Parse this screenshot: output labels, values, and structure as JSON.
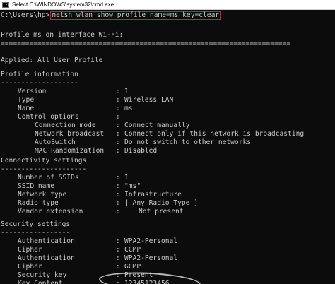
{
  "window": {
    "title": "Select C:\\WINDOWS\\system32\\cmd.exe",
    "icon": "cmd-icon"
  },
  "console": {
    "prompt": "C:\\Users\\hp>",
    "command": "netsh wlan show profile name=ms key=clear",
    "header": "Profile ms on interface Wi-Fi:",
    "rule": "=======================================================================",
    "applied": "Applied: All User Profile",
    "sections": {
      "profile_info": {
        "title": "Profile information",
        "dash": "-------------------",
        "rows": [
          {
            "key": "Version",
            "sep": ":",
            "val": "1",
            "indent": 1
          },
          {
            "key": "Type",
            "sep": ":",
            "val": "Wireless LAN",
            "indent": 1
          },
          {
            "key": "Name",
            "sep": ":",
            "val": "ms",
            "indent": 1
          },
          {
            "key": "Control options",
            "sep": ":",
            "val": "",
            "indent": 1
          },
          {
            "key": "Connection mode",
            "sep": ":",
            "val": "Connect manually",
            "indent": 2
          },
          {
            "key": "Network broadcast",
            "sep": ":",
            "val": "Connect only if this network is broadcasting",
            "indent": 2
          },
          {
            "key": "AutoSwitch",
            "sep": ":",
            "val": "Do not switch to other networks",
            "indent": 2
          },
          {
            "key": "MAC Randomization",
            "sep": ":",
            "val": "Disabled",
            "indent": 2
          }
        ]
      },
      "connectivity": {
        "title": "Connectivity settings",
        "dash": "---------------------",
        "rows": [
          {
            "key": "Number of SSIDs",
            "sep": ":",
            "val": "1",
            "indent": 1
          },
          {
            "key": "SSID name",
            "sep": ":",
            "val": "\"ms\"",
            "indent": 1
          },
          {
            "key": "Network type",
            "sep": ":",
            "val": "Infrastructure",
            "indent": 1
          },
          {
            "key": "Radio type",
            "sep": ":",
            "val": "[ Any Radio Type ]",
            "indent": 1
          },
          {
            "key": "Vendor extension",
            "sep": ":",
            "val": "Not present",
            "indent": 1,
            "offset": true
          }
        ]
      },
      "security": {
        "title": "Security settings",
        "dash": "-----------------",
        "rows": [
          {
            "key": "Authentication",
            "sep": ":",
            "val": "WPA2-Personal",
            "indent": 1
          },
          {
            "key": "Cipher",
            "sep": ":",
            "val": "CCMP",
            "indent": 1
          },
          {
            "key": "Authentication",
            "sep": ":",
            "val": "WPA2-Personal",
            "indent": 1
          },
          {
            "key": "Cipher",
            "sep": ":",
            "val": "GCMP",
            "indent": 1
          },
          {
            "key": "Security key",
            "sep": ":",
            "val": "Present",
            "indent": 1
          },
          {
            "key": "Key Content",
            "sep": ":",
            "val": "12345123456",
            "indent": 1
          }
        ]
      }
    }
  },
  "colors": {
    "background": "#0c0c0c",
    "text": "#c8c8c8",
    "highlight_border": "#d42020"
  }
}
